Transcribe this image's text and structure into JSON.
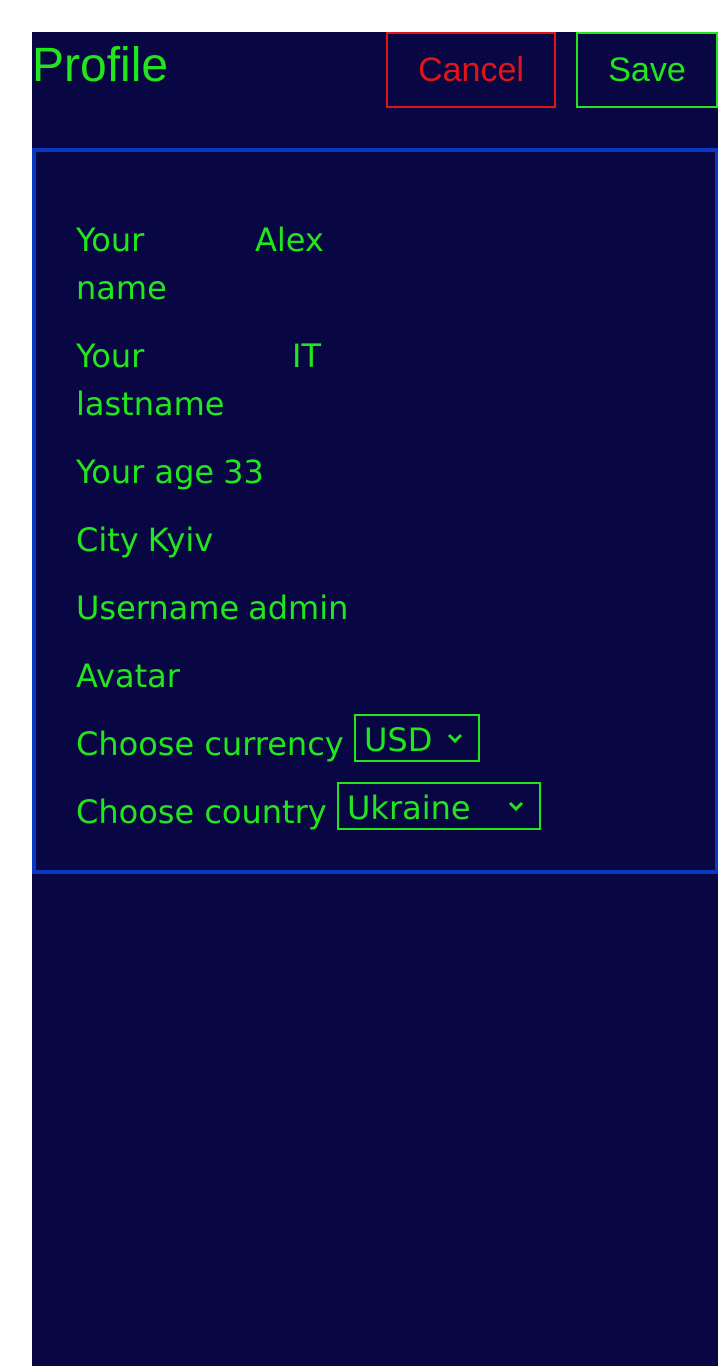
{
  "header": {
    "title": "Profile",
    "cancel_label": "Cancel",
    "save_label": "Save"
  },
  "form": {
    "name_label_line1": "Your",
    "name_label_line2": "name",
    "name_value": "Alex",
    "lastname_label_line1": "Your",
    "lastname_label_line2": "lastname",
    "lastname_value": "IT",
    "age_label": "Your age",
    "age_value": "33",
    "city_label": "City",
    "city_value": "Kyiv",
    "username_label": "Username",
    "username_value": "admin",
    "avatar_label": "Avatar",
    "currency_label": "Choose currency",
    "currency_selected": "USD",
    "country_label": "Choose country",
    "country_selected": "Ukraine"
  },
  "icons": {
    "select_arrow": "chevron-down-icon"
  },
  "colors": {
    "background": "#080744",
    "text": "#21e61c",
    "cancel": "#e0151a",
    "panel_border": "#0a37c4"
  }
}
